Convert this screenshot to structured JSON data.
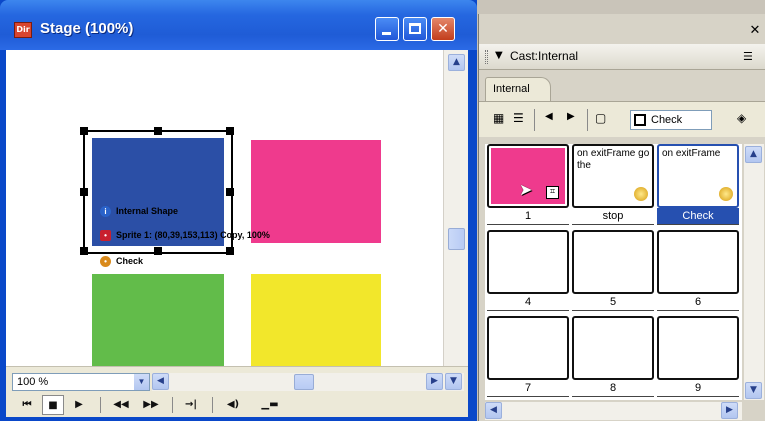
{
  "stage": {
    "title": "Stage (100%)",
    "app_icon": "Dir",
    "sprite_overlay": {
      "line1": "Internal Shape",
      "line2": "Sprite 1: (80,39,153,113) Copy, 100%",
      "line3": "Check"
    },
    "sprite_colors": {
      "blue": "#2b4fa6",
      "pink": "#ef3a8d",
      "green": "#62bc4a",
      "yellow": "#f2e72b"
    },
    "zoom": {
      "value": "100 %"
    },
    "controls": [
      "rewind",
      "stop",
      "play",
      "step-back",
      "step-forward",
      "loop",
      "volume",
      "toggle-display"
    ]
  },
  "cast": {
    "title": "Cast:Internal",
    "tab": "Internal",
    "member_name": "Check",
    "members": [
      {
        "number": "1",
        "label": "1",
        "type": "shape"
      },
      {
        "number": "2",
        "label": "stop",
        "type": "script",
        "script": "on exitFrame go the"
      },
      {
        "number": "3",
        "label": "Check",
        "type": "script",
        "script": "on exitFrame",
        "selected": true
      },
      {
        "number": "4",
        "label": "4",
        "type": "empty"
      },
      {
        "number": "5",
        "label": "5",
        "type": "empty"
      },
      {
        "number": "6",
        "label": "6",
        "type": "empty"
      },
      {
        "number": "7",
        "label": "7",
        "type": "empty"
      },
      {
        "number": "8",
        "label": "8",
        "type": "empty"
      },
      {
        "number": "9",
        "label": "9",
        "type": "empty"
      }
    ]
  }
}
